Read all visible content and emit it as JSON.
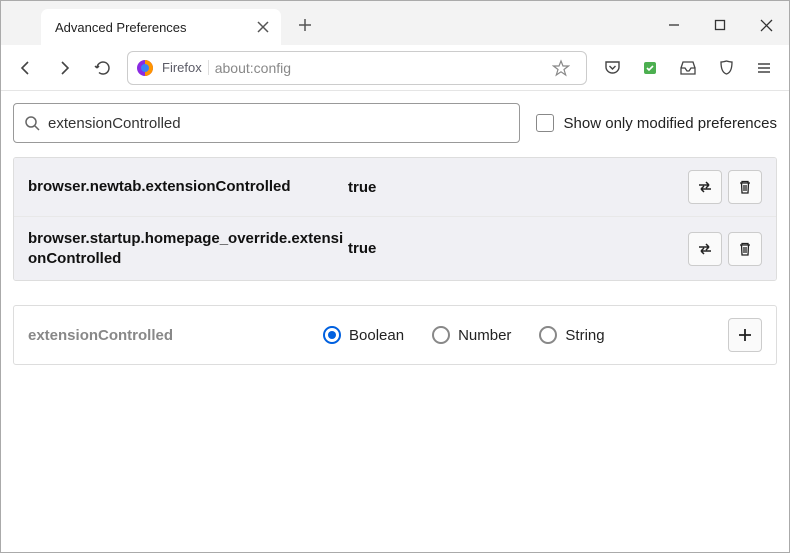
{
  "window": {
    "tab_title": "Advanced Preferences"
  },
  "toolbar": {
    "identity": "Firefox",
    "url": "about:config"
  },
  "search": {
    "value": "extensionControlled",
    "show_only_label": "Show only modified preferences"
  },
  "prefs": [
    {
      "name": "browser.newtab.extensionControlled",
      "value": "true"
    },
    {
      "name": "browser.startup.homepage_override.extensionControlled",
      "value": "true"
    }
  ],
  "add": {
    "name": "extensionControlled",
    "types": [
      "Boolean",
      "Number",
      "String"
    ],
    "selected": "Boolean"
  }
}
